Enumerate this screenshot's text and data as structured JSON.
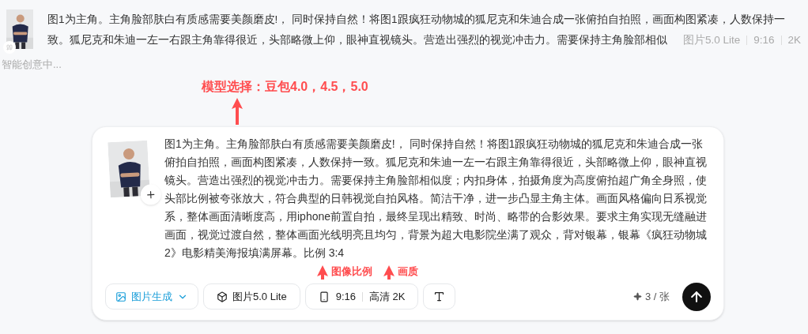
{
  "history": {
    "thumbnail": {
      "kind": "picture"
    },
    "lines": [
      "图1为主角。主角脸部肤白有质感需要美颜磨皮!， 同时保持自然！将图1跟疯狂动物城的狐尼克和朱迪合成一张俯拍自拍照，画面构图紧凑，人数保持一",
      "致。狐尼克和朱迪一左一右跟主角靠得很近，头部略微上仰，眼神直视镜头。营造出强烈的视觉冲击力。需要保持主角脸部相似"
    ],
    "meta": [
      "图片5.0 Lite",
      "9:16",
      "2K"
    ]
  },
  "status": "智能创意中...",
  "composer": {
    "thumbnail": {
      "kind": "picture"
    },
    "prompt": "图1为主角。主角脸部肤白有质感需要美颜磨皮!， 同时保持自然！将图1跟疯狂动物城的狐尼克和朱迪合成一张俯拍自拍照，画面构图紧凑，人数保持一致。狐尼克和朱迪一左一右跟主角靠得很近，头部略微上仰，眼神直视镜头。营造出强烈的视觉冲击力。需要保持主角脸部相似度；内扣身体，拍摄角度为高度俯拍超广角全身照，使头部比例被夸张放大，符合典型的日韩视觉自拍风格。简洁干净，进一步凸显主角主体。画面风格偏向日系视觉系，整体画面清晰度高，用iphone前置自拍，最终呈现出精致、时尚、略带的合影效果。要求主角实现无缝融进画面，视觉过渡自然，整体画面光线明亮且均匀，背景为超大电影院坐满了观众，背对银幕，银幕《疯狂动物城2》电影精美海报填满屏幕。比例 3:4",
    "tools": [
      {
        "kind": "mode",
        "label": "图片生成"
      },
      {
        "kind": "model",
        "label": "图片5.0 Lite"
      },
      {
        "kind": "size",
        "ratio": "9:16",
        "quality": "高清 2K"
      },
      {
        "kind": "format"
      }
    ],
    "credits": "3 / 张"
  },
  "annotations": [
    {
      "text": "模型选择：豆包4.0，4.5，5.0"
    },
    {
      "text": "图像比例"
    },
    {
      "text": "画质"
    }
  ]
}
